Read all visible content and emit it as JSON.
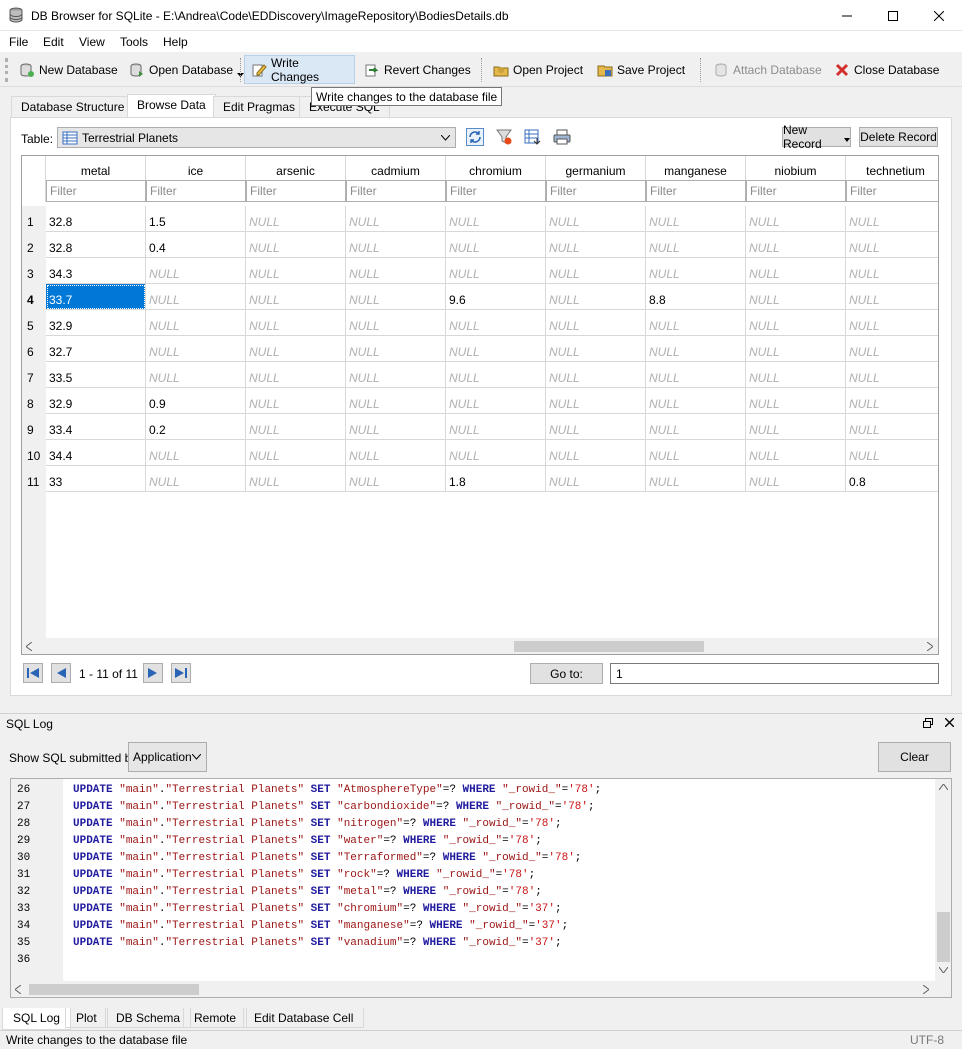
{
  "window": {
    "title": "DB Browser for SQLite - E:\\Andrea\\Code\\EDDiscovery\\ImageRepository\\BodiesDetails.db"
  },
  "menu": [
    "File",
    "Edit",
    "View",
    "Tools",
    "Help"
  ],
  "toolbar": {
    "new_db": "New Database",
    "open_db": "Open Database",
    "write": "Write Changes",
    "revert": "Revert Changes",
    "open_project": "Open Project",
    "save_project": "Save Project",
    "attach": "Attach Database",
    "close": "Close Database"
  },
  "tooltip": "Write changes to the database file",
  "tabs": [
    "Database Structure",
    "Browse Data",
    "Edit Pragmas",
    "Execute SQL"
  ],
  "browse": {
    "table_label": "Table:",
    "table_value": "Terrestrial Planets",
    "new_record": "New Record",
    "delete_record": "Delete Record",
    "filter_placeholder": "Filter",
    "null_text": "NULL",
    "columns": [
      "metal",
      "ice",
      "arsenic",
      "cadmium",
      "chromium",
      "germanium",
      "manganese",
      "niobium",
      "technetium"
    ],
    "row_numbers": [
      "1",
      "2",
      "3",
      "4",
      "5",
      "6",
      "7",
      "8",
      "9",
      "10",
      "11"
    ],
    "rows": [
      [
        "32.8",
        "1.5",
        null,
        null,
        null,
        null,
        null,
        null,
        null
      ],
      [
        "32.8",
        "0.4",
        null,
        null,
        null,
        null,
        null,
        null,
        null
      ],
      [
        "34.3",
        null,
        null,
        null,
        null,
        null,
        null,
        null,
        null
      ],
      [
        "33.7",
        null,
        null,
        null,
        "9.6",
        null,
        "8.8",
        null,
        null
      ],
      [
        "32.9",
        null,
        null,
        null,
        null,
        null,
        null,
        null,
        null
      ],
      [
        "32.7",
        null,
        null,
        null,
        null,
        null,
        null,
        null,
        null
      ],
      [
        "33.5",
        null,
        null,
        null,
        null,
        null,
        null,
        null,
        null
      ],
      [
        "32.9",
        "0.9",
        null,
        null,
        null,
        null,
        null,
        null,
        null
      ],
      [
        "33.4",
        "0.2",
        null,
        null,
        null,
        null,
        null,
        null,
        null
      ],
      [
        "34.4",
        null,
        null,
        null,
        null,
        null,
        null,
        null,
        null
      ],
      [
        "33",
        null,
        null,
        null,
        "1.8",
        null,
        null,
        null,
        "0.8"
      ]
    ],
    "record_count": "1 - 11 of 11",
    "goto_label": "Go to:",
    "goto_value": "1"
  },
  "sqllog": {
    "title": "SQL Log",
    "show_label": "Show SQL submitted by",
    "show_value": "Application",
    "clear": "Clear",
    "lines": [
      {
        "n": "26",
        "col": "AtmosphereType",
        "rowid": "78"
      },
      {
        "n": "27",
        "col": "carbondioxide",
        "rowid": "78"
      },
      {
        "n": "28",
        "col": "nitrogen",
        "rowid": "78"
      },
      {
        "n": "29",
        "col": "water",
        "rowid": "78"
      },
      {
        "n": "30",
        "col": "Terraformed",
        "rowid": "78"
      },
      {
        "n": "31",
        "col": "rock",
        "rowid": "78"
      },
      {
        "n": "32",
        "col": "metal",
        "rowid": "78"
      },
      {
        "n": "33",
        "col": "chromium",
        "rowid": "37"
      },
      {
        "n": "34",
        "col": "manganese",
        "rowid": "37"
      },
      {
        "n": "35",
        "col": "vanadium",
        "rowid": "37"
      },
      {
        "n": "36",
        "col": null,
        "rowid": null
      }
    ],
    "sql_update": "UPDATE",
    "sql_schema": "\"main\"",
    "sql_table": "\"Terrestrial Planets\"",
    "sql_set": "SET",
    "sql_where": "WHERE",
    "sql_rowid": "\"_rowid_\""
  },
  "bottom_tabs": [
    "SQL Log",
    "Plot",
    "DB Schema",
    "Remote",
    "Edit Database Cell"
  ],
  "status": {
    "message": "Write changes to the database file",
    "encoding": "UTF-8"
  },
  "colors": {
    "selection": "#0078d7",
    "accent_hover": "#dae7f5"
  }
}
